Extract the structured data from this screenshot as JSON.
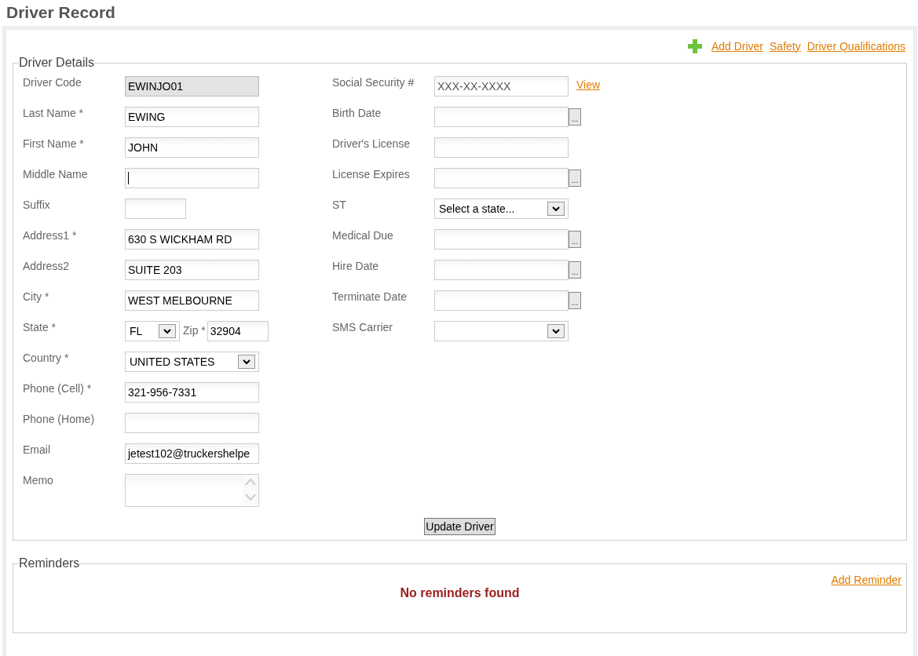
{
  "page_title": "Driver Record",
  "top_links": [
    {
      "kind": "add",
      "label": "Add Driver"
    },
    {
      "kind": "link",
      "label": "Safety"
    },
    {
      "kind": "link",
      "label": "Driver Qualifications"
    }
  ],
  "details": {
    "legend": "Driver Details",
    "left_fields": [
      {
        "label": "Driver Code",
        "kind": "readonly",
        "value": "EWINJO01"
      },
      {
        "label": "Last Name *",
        "kind": "text",
        "value": "EWING"
      },
      {
        "label": "First Name *",
        "kind": "text",
        "value": "JOHN"
      },
      {
        "label": "Middle Name",
        "kind": "text",
        "focused": true
      },
      {
        "label": "Suffix",
        "kind": "short"
      },
      {
        "label": "Address1 *",
        "kind": "text",
        "value": "630 S WICKHAM RD"
      },
      {
        "label": "Address2",
        "kind": "text",
        "value": "SUITE 203"
      },
      {
        "label": "City *",
        "kind": "text",
        "value": "WEST MELBOURNE"
      },
      {
        "label": "State *",
        "kind": "state_zip",
        "value": "FL",
        "zip_label": "Zip *",
        "zip_value": "32904"
      },
      {
        "label": "Country *",
        "kind": "select",
        "value": "UNITED STATES"
      },
      {
        "label": "Phone (Cell) *",
        "kind": "text",
        "value": "321-956-7331"
      },
      {
        "label": "Phone (Home)",
        "kind": "text"
      },
      {
        "label": "Email",
        "kind": "text",
        "value": "jetest102@truckershelpe"
      },
      {
        "label": "Memo",
        "kind": "textarea"
      }
    ],
    "right_fields": [
      {
        "label": "Social Security #",
        "kind": "masked",
        "value": "XXX-XX-XXXX",
        "link": "View"
      },
      {
        "label": "Birth Date",
        "kind": "date",
        "button": "..."
      },
      {
        "label": "Driver's License",
        "kind": "text"
      },
      {
        "label": "License Expires",
        "kind": "date",
        "button": "..."
      },
      {
        "label": "ST",
        "kind": "select",
        "value": "Select a state..."
      },
      {
        "label": "Medical Due",
        "kind": "date",
        "button": "..."
      },
      {
        "label": "Hire Date",
        "kind": "date",
        "button": "..."
      },
      {
        "label": "Terminate Date",
        "kind": "date",
        "button": "..."
      },
      {
        "label": "SMS Carrier",
        "kind": "select"
      }
    ],
    "submit": "Update Driver"
  },
  "reminders": {
    "legend": "Reminders",
    "add_link": "Add Reminder",
    "empty_message": "No reminders found"
  }
}
